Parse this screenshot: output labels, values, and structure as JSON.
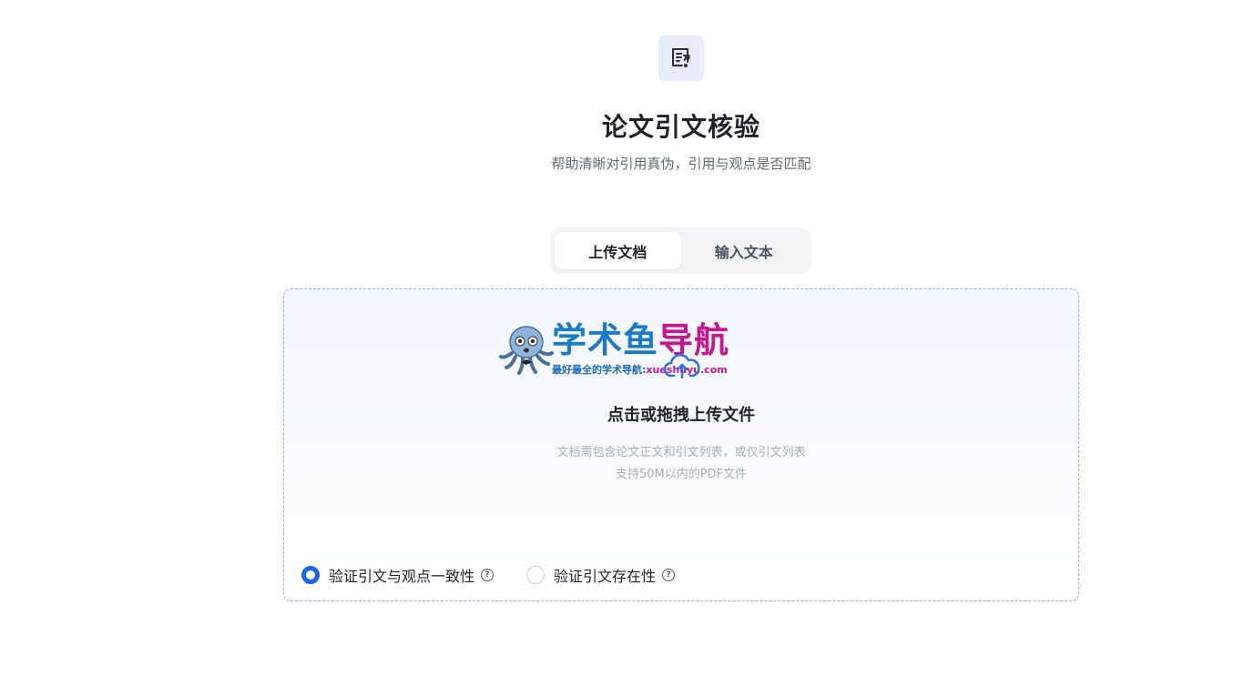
{
  "header": {
    "app_icon": "citation-document-icon",
    "title": "论文引文核验",
    "subtitle": "帮助清晰对引用真伪，引用与观点是否匹配"
  },
  "tabs": [
    {
      "label": "上传文档",
      "active": true
    },
    {
      "label": "输入文本",
      "active": false
    }
  ],
  "upload": {
    "icon": "cloud-upload-icon",
    "title": "点击或拖拽上传文件",
    "hint_line1": "文档需包含论文正文和引文列表，或仅引文列表",
    "hint_line2": "支持50M以内的PDF文件"
  },
  "watermark": {
    "title_part1": "学术鱼",
    "title_part2": "导航",
    "sub_part1": "最好最全的学术导航:",
    "sub_part2": "xueshuyu.com"
  },
  "options": [
    {
      "label": "验证引文与观点一致性",
      "checked": true
    },
    {
      "label": "验证引文存在性",
      "checked": false
    }
  ],
  "help_glyph": "?",
  "colors": {
    "accent": "#1f66e5",
    "icon_bg": "#e6edf8",
    "upload_border": "#8fb1e8",
    "watermark_blue": "#1b7bc7",
    "watermark_magenta": "#c3188f"
  }
}
